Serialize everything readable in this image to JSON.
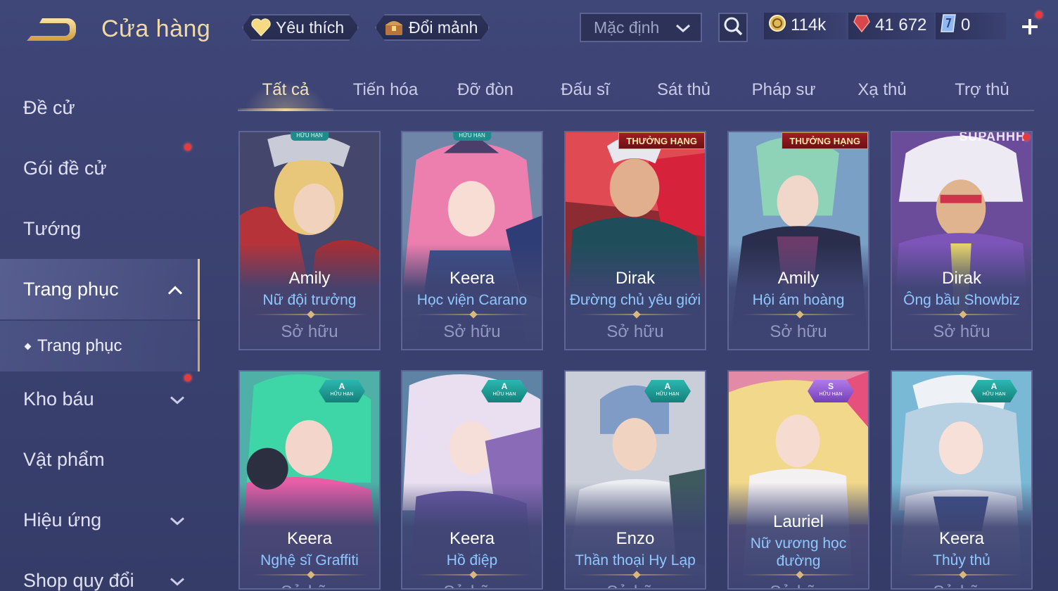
{
  "header": {
    "title": "Cửa hàng",
    "favorite_label": "Yêu thích",
    "shard_label": "Đổi mảnh",
    "sort_value": "Mặc định",
    "currencies": {
      "gold": "114k",
      "ruby": "41 672",
      "voucher": "0"
    }
  },
  "sidebar": {
    "items": [
      {
        "label": "Đề cử"
      },
      {
        "label": "Gói đề cử"
      },
      {
        "label": "Tướng"
      },
      {
        "label": "Trang phục"
      },
      {
        "label": "Kho báu"
      },
      {
        "label": "Vật phẩm"
      },
      {
        "label": "Hiệu ứng"
      },
      {
        "label": "Shop quy đổi"
      }
    ],
    "sub_item": "Trang phục"
  },
  "tabs": [
    "Tất cả",
    "Tiến hóa",
    "Đỡ đòn",
    "Đấu sĩ",
    "Sát thủ",
    "Pháp sư",
    "Xạ thủ",
    "Trợ thủ"
  ],
  "badges": {
    "limited": "HỮU HẠN",
    "rank": "THƯỞNG HẠNG",
    "grade_a": "A",
    "grade_s": "S",
    "showbiz": "SUPAHHH"
  },
  "cards": [
    {
      "hero": "Amily",
      "skin": "Nữ đội trưởng",
      "status": "Sở hữu"
    },
    {
      "hero": "Keera",
      "skin": "Học viện Carano",
      "status": "Sở hữu"
    },
    {
      "hero": "Dirak",
      "skin": "Đường chủ yêu giới",
      "status": "Sở hữu"
    },
    {
      "hero": "Amily",
      "skin": "Hội ám hoàng",
      "status": "Sở hữu"
    },
    {
      "hero": "Dirak",
      "skin": "Ông bầu Showbiz",
      "status": "Sở hữu"
    },
    {
      "hero": "Keera",
      "skin": "Nghệ sĩ Graffiti",
      "status": "Sở hữu"
    },
    {
      "hero": "Keera",
      "skin": "Hồ điệp",
      "status": "Sở hữu"
    },
    {
      "hero": "Enzo",
      "skin": "Thần thoại Hy Lạp",
      "status": "Sở hữu"
    },
    {
      "hero": "Lauriel",
      "skin_line1": "Nữ vương học",
      "skin_line2": "đường",
      "status": "Sở hữu"
    },
    {
      "hero": "Keera",
      "skin": "Thủy thủ",
      "status": "Sở hữu"
    }
  ],
  "colors": {
    "background": "#3b4270",
    "accent_gold": "#f0d9a8",
    "skin_name": "#8fc8ff",
    "grade_a": "#1f9b93",
    "grade_s": "#8c55cc",
    "rank_red": "#8e1a1f"
  }
}
